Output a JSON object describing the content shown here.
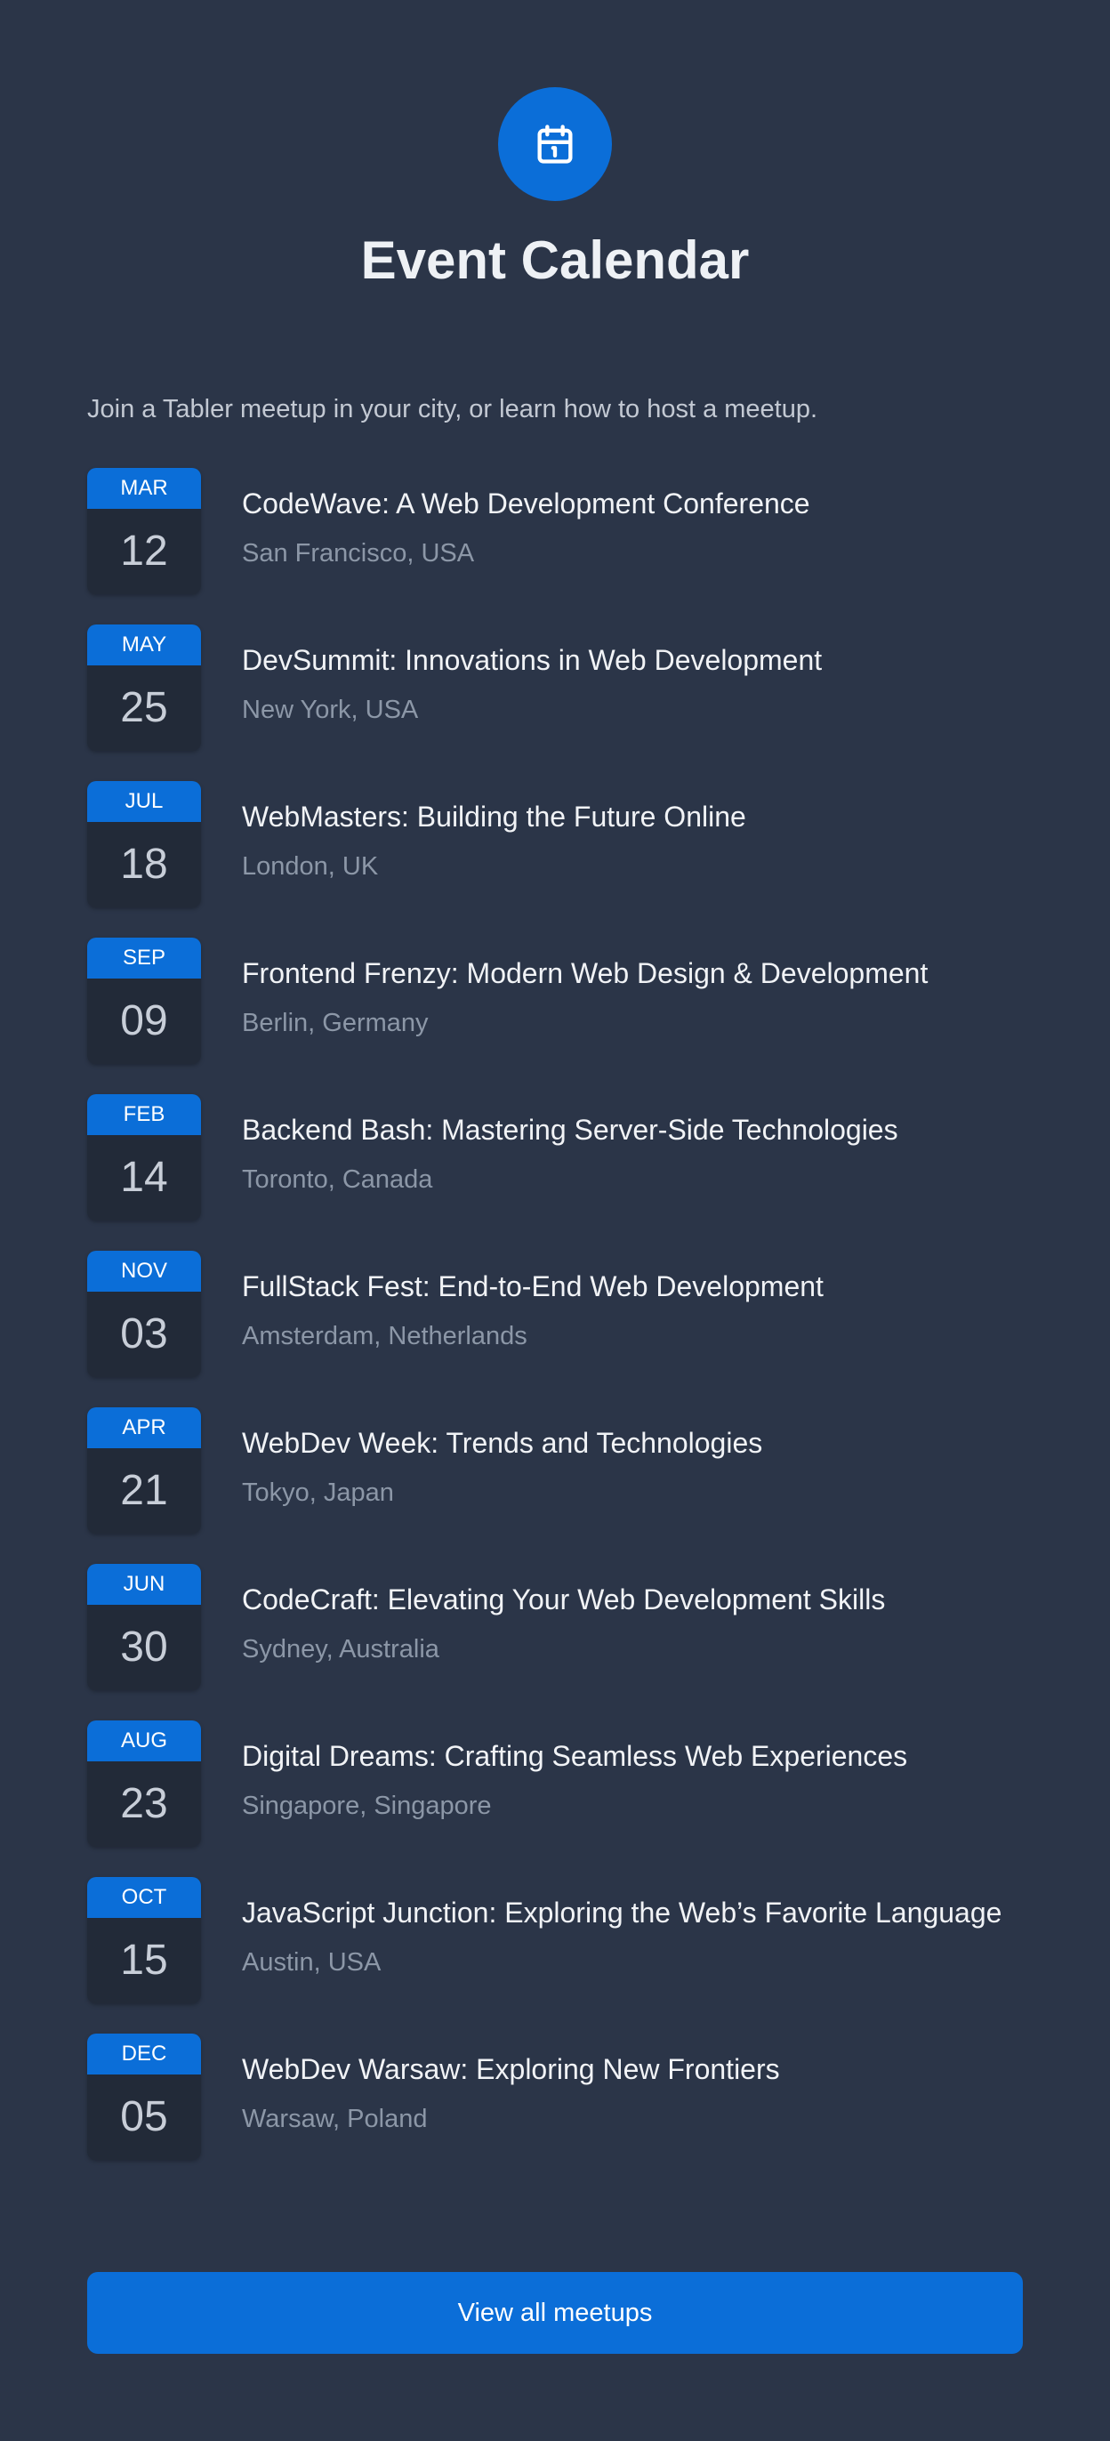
{
  "header": {
    "icon": "calendar-icon",
    "title": "Event Calendar",
    "intro": "Join a Tabler meetup in your city, or learn how to host a meetup."
  },
  "events": [
    {
      "month": "MAR",
      "day": "12",
      "title": "CodeWave: A Web Development Conference",
      "location": "San Francisco, USA"
    },
    {
      "month": "MAY",
      "day": "25",
      "title": "DevSummit: Innovations in Web Development",
      "location": "New York, USA"
    },
    {
      "month": "JUL",
      "day": "18",
      "title": "WebMasters: Building the Future Online",
      "location": "London, UK"
    },
    {
      "month": "SEP",
      "day": "09",
      "title": "Frontend Frenzy: Modern Web Design & Development",
      "location": "Berlin, Germany"
    },
    {
      "month": "FEB",
      "day": "14",
      "title": "Backend Bash: Mastering Server-Side Technologies",
      "location": "Toronto, Canada"
    },
    {
      "month": "NOV",
      "day": "03",
      "title": "FullStack Fest: End-to-End Web Development",
      "location": "Amsterdam, Netherlands"
    },
    {
      "month": "APR",
      "day": "21",
      "title": "WebDev Week: Trends and Technologies",
      "location": "Tokyo, Japan"
    },
    {
      "month": "JUN",
      "day": "30",
      "title": "CodeCraft: Elevating Your Web Development Skills",
      "location": "Sydney, Australia"
    },
    {
      "month": "AUG",
      "day": "23",
      "title": "Digital Dreams: Crafting Seamless Web Experiences",
      "location": "Singapore, Singapore"
    },
    {
      "month": "OCT",
      "day": "15",
      "title": "JavaScript Junction: Exploring the Web’s Favorite Language",
      "location": "Austin, USA"
    },
    {
      "month": "DEC",
      "day": "05",
      "title": "WebDev Warsaw: Exploring New Frontiers",
      "location": "Warsaw, Poland"
    }
  ],
  "cta": {
    "label": "View all meetups"
  },
  "colors": {
    "background": "#2b3548",
    "accent": "#0b6ed8",
    "date_box": "#222a38",
    "text_primary": "#f1f3f6",
    "text_secondary": "#8c97a7"
  }
}
